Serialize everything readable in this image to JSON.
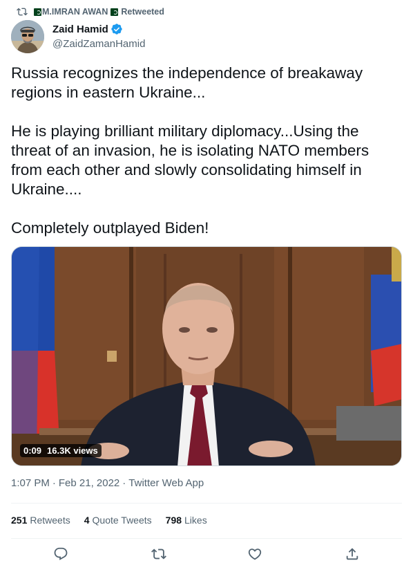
{
  "retweet": {
    "retweeter": "M.IMRAN AWAN",
    "label": "Retweeted"
  },
  "author": {
    "display_name": "Zaid Hamid",
    "handle": "@ZaidZamanHamid"
  },
  "tweet": {
    "text": "Russia recognizes the independence of breakaway regions in eastern Ukraine...\n\nHe is playing brilliant military diplomacy...Using the threat of an invasion, he is isolating NATO members from each other and slowly consolidating himself in Ukraine....\n\nCompletely outplayed Biden!"
  },
  "media": {
    "duration": "0:09",
    "views": "16.3K views"
  },
  "meta": {
    "time": "1:07 PM",
    "date": "Feb 21, 2022",
    "source": "Twitter Web App",
    "dot": "·"
  },
  "stats": {
    "retweets_count": "251",
    "retweets_label": "Retweets",
    "quotes_count": "4",
    "quotes_label": "Quote Tweets",
    "likes_count": "798",
    "likes_label": "Likes"
  },
  "colors": {
    "text_primary": "#0f1419",
    "text_secondary": "#536471",
    "verified_blue": "#1d9bf0",
    "divider": "#eff3f4"
  },
  "icons": {
    "retweet_header": "retweet-icon",
    "verified": "verified-badge-icon",
    "reply": "reply-icon",
    "retweet": "retweet-icon",
    "like": "heart-icon",
    "share": "share-icon"
  }
}
